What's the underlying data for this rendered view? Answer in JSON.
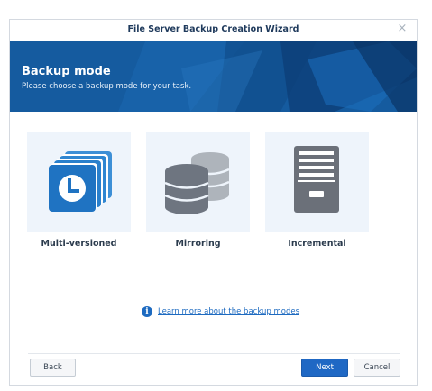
{
  "window": {
    "title": "File Server Backup Creation Wizard",
    "close_glyph": "×"
  },
  "banner": {
    "heading": "Backup mode",
    "subheading": "Please choose a backup mode for your task."
  },
  "modes": [
    {
      "label": "Multi-versioned",
      "icon": "clock-stack-icon"
    },
    {
      "label": "Mirroring",
      "icon": "database-icon"
    },
    {
      "label": "Incremental",
      "icon": "file-cabinet-icon"
    }
  ],
  "help": {
    "info_glyph": "i",
    "link_text": "Learn more about the backup modes"
  },
  "footer": {
    "back_label": "Back",
    "next_label": "Next",
    "cancel_label": "Cancel"
  },
  "colors": {
    "banner": "#155b9f",
    "accent": "#1f68c4",
    "card_background": "#eef4fb"
  }
}
